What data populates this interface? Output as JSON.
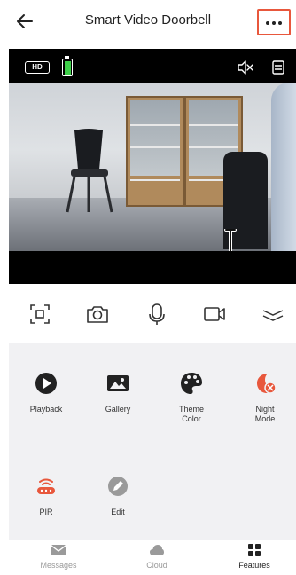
{
  "header": {
    "title": "Smart Video Doorbell"
  },
  "video": {
    "quality_badge": "HD",
    "battery_color": "#3ecf4a"
  },
  "controls": [
    {
      "name": "screenshot-frame-icon"
    },
    {
      "name": "camera-icon"
    },
    {
      "name": "microphone-icon"
    },
    {
      "name": "video-record-icon"
    },
    {
      "name": "collapse-chevron-icon"
    }
  ],
  "features": [
    {
      "label": "Playback",
      "icon": "play-icon",
      "color": "#222222"
    },
    {
      "label": "Gallery",
      "icon": "gallery-icon",
      "color": "#222222"
    },
    {
      "label": "Theme\nColor",
      "icon": "palette-icon",
      "color": "#222222"
    },
    {
      "label": "Night\nMode",
      "icon": "night-mode-icon",
      "color": "#e8573c"
    },
    {
      "label": "PIR",
      "icon": "pir-icon",
      "color": "#e8573c"
    },
    {
      "label": "Edit",
      "icon": "edit-icon",
      "color": "#9a9a9a"
    }
  ],
  "nav": [
    {
      "label": "Messages",
      "icon": "messages-icon"
    },
    {
      "label": "Cloud",
      "icon": "cloud-icon"
    },
    {
      "label": "Features",
      "icon": "features-grid-icon",
      "active": true
    }
  ]
}
